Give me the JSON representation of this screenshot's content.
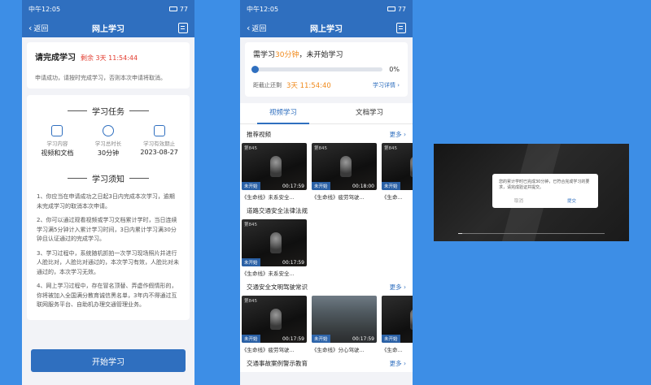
{
  "status": {
    "time": "中午12:05",
    "battery": "77"
  },
  "nav": {
    "back_label": "返回",
    "title": "网上学习"
  },
  "apply": {
    "title": "请完成学习",
    "remaining": "剩余 3天 11:54:44",
    "message": "申请成功，请按时完成学习，否则本次申请将取消。"
  },
  "task": {
    "section_title": "学习任务",
    "items": [
      {
        "icon": "book-icon",
        "label": "学习内容",
        "value": "视频和文档"
      },
      {
        "icon": "clock-icon",
        "label": "学习总时长",
        "value": "30分钟"
      },
      {
        "icon": "calendar-icon",
        "label": "学习有效期止",
        "value": "2023-08-27"
      }
    ]
  },
  "notice": {
    "section_title": "学习须知",
    "items": [
      "1、你应当在申请成功之日起3日内完成本次学习，逾期未完成学习的取消本次申请。",
      "2、你可以通过观看视频或学习文档累计学时，当日连续学习满5分钟计入累计学习时间，3日内累计学习满30分钟且认证通过的完成学习。",
      "3、学习过程中，系统随机抓拍一次学习现场照片并进行人脸比对，人脸比对通过的，本次学习有效，人脸比对未通过的，本次学习无效。",
      "4、网上学习过程中，存在冒名顶替、弄虚作假情形的，你将被加入全国满分教育诚信黑名单，3年内不得通过互联网服务平台、自助机办理交通管理业务。"
    ]
  },
  "start_button": "开始学习",
  "progress": {
    "prefix": "需学习",
    "minutes": "30分钟",
    "suffix": "，未开始学习",
    "percent_label": "0%",
    "percent": 0,
    "deadline_label": "距截止还剩",
    "countdown": "3天 11:54:40",
    "detail_link": "学习详情 ›"
  },
  "tabs": [
    {
      "label": "视频学习",
      "active": true
    },
    {
      "label": "文档学习",
      "active": false
    }
  ],
  "categories": [
    {
      "name": "推荐视频",
      "more": "更多 ›",
      "videos": [
        {
          "no": "第845",
          "status": "未开始",
          "duration": "00:17:59",
          "title": "《生命线》未系安全..."
        },
        {
          "no": "第845",
          "status": "未开始",
          "duration": "00:18:00",
          "title": "《生命线》疲劳驾驶..."
        },
        {
          "no": "第845",
          "status": "未开始",
          "duration": "00:1",
          "title": "《生命..."
        }
      ]
    },
    {
      "name": "道路交通安全法律法规",
      "more": "",
      "videos": [
        {
          "no": "第845",
          "status": "未开始",
          "duration": "00:17:59",
          "title": "《生命线》未系安全..."
        }
      ]
    },
    {
      "name": "交通安全文明驾驶常识",
      "more": "更多 ›",
      "videos": [
        {
          "no": "第845",
          "status": "未开始",
          "duration": "00:17:59",
          "title": "《生命线》疲劳驾驶..."
        },
        {
          "no": "",
          "status": "未开始",
          "duration": "00:17:59",
          "title": "《生命线》分心驾驶..."
        },
        {
          "no": "",
          "status": "未开始",
          "duration": "00:1",
          "title": "《生命..."
        }
      ]
    },
    {
      "name": "交通事故案例警示教育",
      "more": "更多 ›",
      "videos": []
    }
  ],
  "video_popup": {
    "message": "您的累计学时已完成30分钟，已符合完成学习的要求，请完成验证并提交。",
    "cancel": "取消",
    "confirm": "提交"
  }
}
